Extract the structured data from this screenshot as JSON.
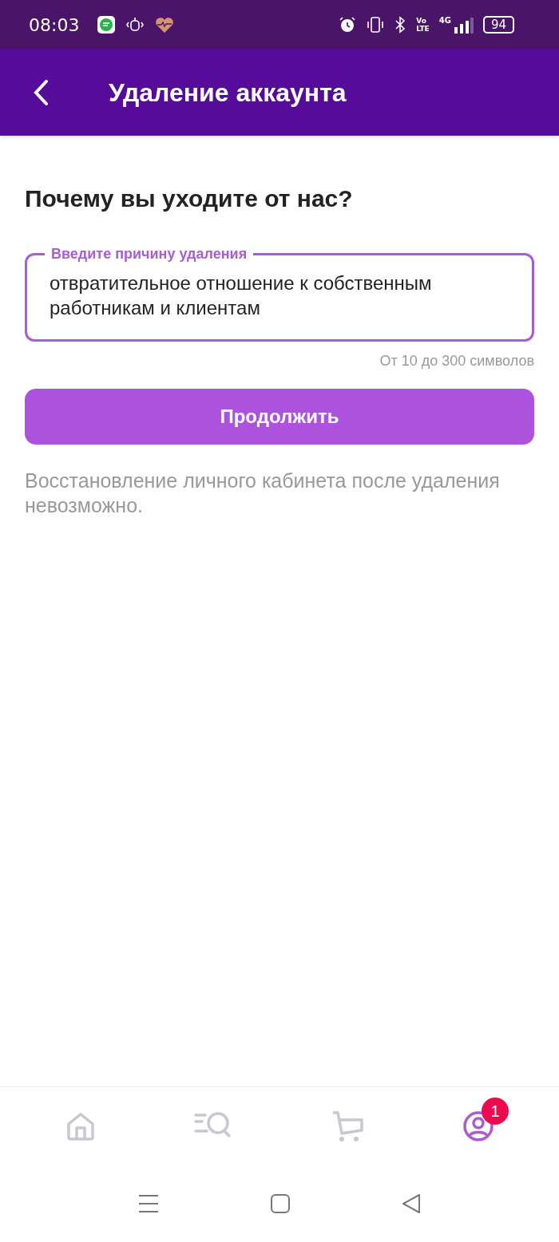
{
  "status_bar": {
    "time": "08:03",
    "volte": [
      "Vo",
      "LTE"
    ],
    "network": "4G",
    "battery": "94"
  },
  "header": {
    "title": "Удаление аккаунта"
  },
  "question": "Почему вы уходите от нас?",
  "reason_field": {
    "label": "Введите причину удаления",
    "value": "отвратительное отношение к собственным работникам и клиентам",
    "hint": "От 10 до 300 символов"
  },
  "continue_button": "Продолжить",
  "note": "Восстановление личного кабинета после удаления невозможно.",
  "bottom_nav": [
    {
      "kind": "home",
      "selected": false
    },
    {
      "kind": "catalog",
      "selected": false
    },
    {
      "kind": "cart",
      "selected": false
    },
    {
      "kind": "profile",
      "selected": true,
      "badge": "1"
    }
  ]
}
